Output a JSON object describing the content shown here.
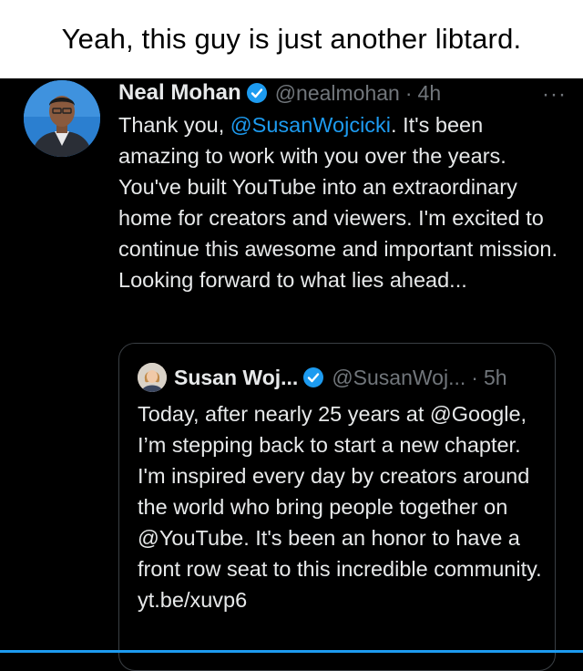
{
  "caption": "Yeah, this guy is just another libtard.",
  "tweet": {
    "author_name": "Neal Mohan",
    "author_handle": "@nealmohan",
    "separator": "·",
    "time": "4h",
    "more_label": "···",
    "body_prefix": "Thank you, ",
    "body_mention": "@SusanWojcicki",
    "body_suffix": ". It's been amazing to work with you over the years. You've built YouTube into an extraordinary home for creators and viewers. I'm excited to continue this awesome and important mission. Looking forward to what lies ahead..."
  },
  "quoted_tweet": {
    "author_name": "Susan Woj...",
    "author_handle": "@SusanWoj...",
    "separator": "·",
    "time": "5h",
    "body": "Today, after nearly 25 years at @Google, I’m stepping back to start a new chapter.  I'm inspired every day by creators around the world who bring people together on @YouTube. It's been an honor to have a front row seat to this incredible community. yt.be/xuvp6"
  },
  "icons": {
    "verified": "verified-badge-icon",
    "more": "more-options-icon"
  },
  "colors": {
    "background": "#000000",
    "caption_background": "#ffffff",
    "text": "#e7e9ea",
    "secondary_text": "#71767b",
    "accent": "#1d9bf0"
  }
}
